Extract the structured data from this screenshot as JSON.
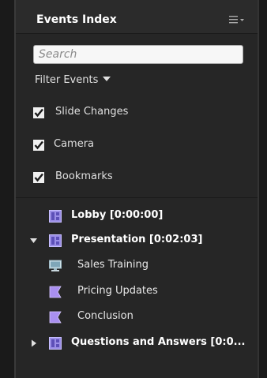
{
  "panel": {
    "title": "Events Index",
    "menu_icon": "panel-menu-icon"
  },
  "search": {
    "placeholder": "Search",
    "value": ""
  },
  "filter": {
    "label": "Filter Events"
  },
  "filters": [
    {
      "label": "Slide Changes",
      "checked": true
    },
    {
      "label": "Camera",
      "checked": true
    },
    {
      "label": "Bookmarks",
      "checked": true
    }
  ],
  "tree": {
    "lobby": {
      "label": "Lobby [0:00:00]",
      "icon": "slide-layout-icon"
    },
    "presentation": {
      "label": "Presentation [0:02:03]",
      "icon": "slide-layout-icon",
      "expanded": true,
      "children": [
        {
          "label": "Sales Training",
          "icon": "monitor-icon"
        },
        {
          "label": "Pricing Updates",
          "icon": "bookmark-flag-icon"
        },
        {
          "label": "Conclusion",
          "icon": "bookmark-flag-icon"
        }
      ]
    },
    "qa": {
      "label": "Questions and Answers [0:0...",
      "icon": "slide-layout-icon",
      "expanded": false
    }
  },
  "colors": {
    "background": "#262626",
    "slide_icon": "#9b8ee6",
    "flag_icon": "#a98ff0",
    "monitor_icon": "#8fb7c9"
  }
}
